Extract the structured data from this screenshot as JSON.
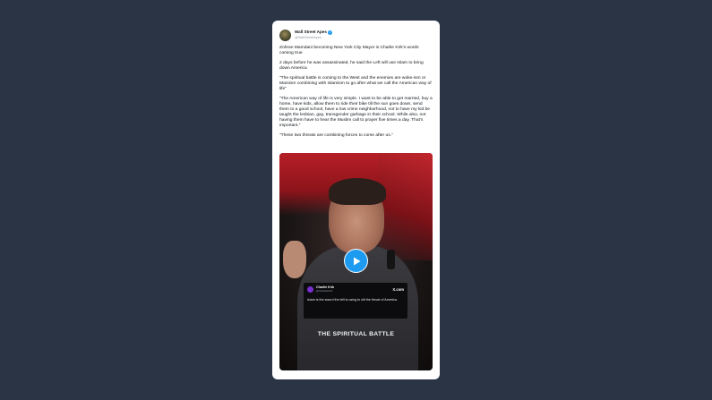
{
  "tweet": {
    "display_name": "Wall Street Apes",
    "handle": "@WallStreetApes",
    "paragraphs": [
      "Zohran Mamdani becoming New York City Mayor is Charlie Kirk's words coming true",
      "2 days before he was assassinated, he said the Left will use Islam to bring down America",
      "“The spiritual battle is coming to the West and the enemies are woke-ism or Marxism combining with Islamism to go after what we call the American way of life”",
      "“The American way of life is very simple. I want to be able to get married, buy a home, have kids, allow them to ride their bike till the sun goes down, send them to a good school, have a low crime neighborhood, not to have my kid be taught the lesbian, gay, transgender garbage in their school. While also, not having them have to hear the Muslim call to prayer five times a day. That's important.”",
      "“These two threats are combining forces to come after us.”"
    ]
  },
  "video": {
    "embedded_card": {
      "name": "Charlie Kirk",
      "handle": "@charliekirk11",
      "platform": "X.com",
      "text": "Islam is the sword the left is using to slit the throat of America."
    },
    "caption": "THE SPIRITUAL BATTLE",
    "play_icon": "play-icon",
    "accent_color": "#1d9bf0"
  }
}
